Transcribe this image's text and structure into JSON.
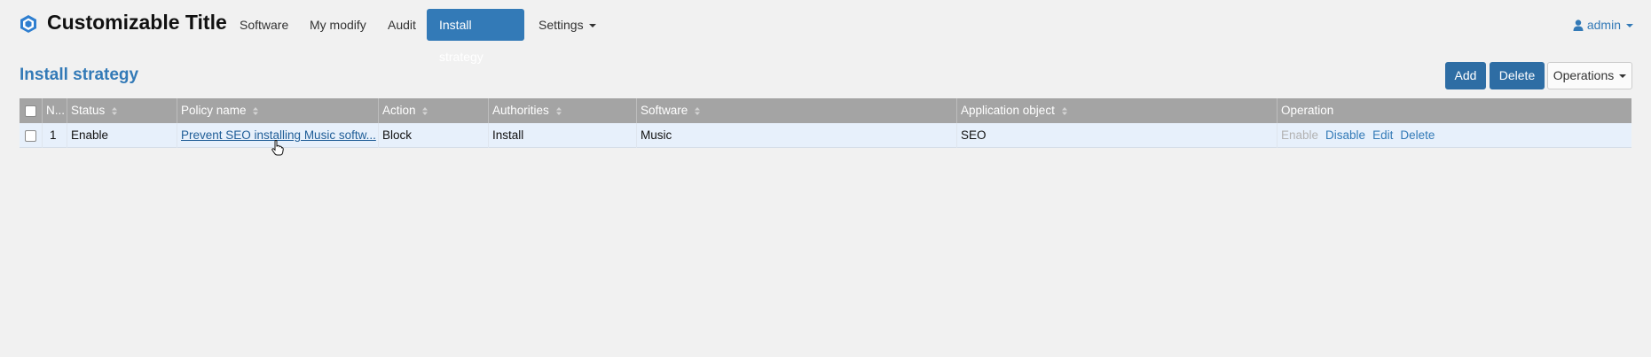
{
  "app": {
    "title": "Customizable Title"
  },
  "nav": {
    "items": [
      {
        "label": "Software"
      },
      {
        "label": "My modify"
      },
      {
        "label": "Audit"
      },
      {
        "label": "Install strategy"
      },
      {
        "label": "Settings"
      }
    ],
    "active": "Install strategy",
    "user": "admin"
  },
  "page": {
    "title": "Install strategy",
    "buttons": {
      "add": "Add",
      "delete": "Delete",
      "operations": "Operations"
    }
  },
  "table": {
    "columns": [
      "N...",
      "Status",
      "Policy name",
      "Action",
      "Authorities",
      "Software",
      "Application object",
      "Operation"
    ],
    "rows": [
      {
        "no": "1",
        "status": "Enable",
        "policy_name": "Prevent SEO installing Music softw...",
        "action": "Block",
        "authorities": "Install",
        "software": "Music",
        "application_object": "SEO",
        "operations": {
          "enable": "Enable",
          "disable": "Disable",
          "edit": "Edit",
          "delete": "Delete"
        }
      }
    ]
  },
  "colors": {
    "accent": "#337ab7",
    "header_bg": "#a4a4a4",
    "row_bg": "#e7f0fb"
  }
}
